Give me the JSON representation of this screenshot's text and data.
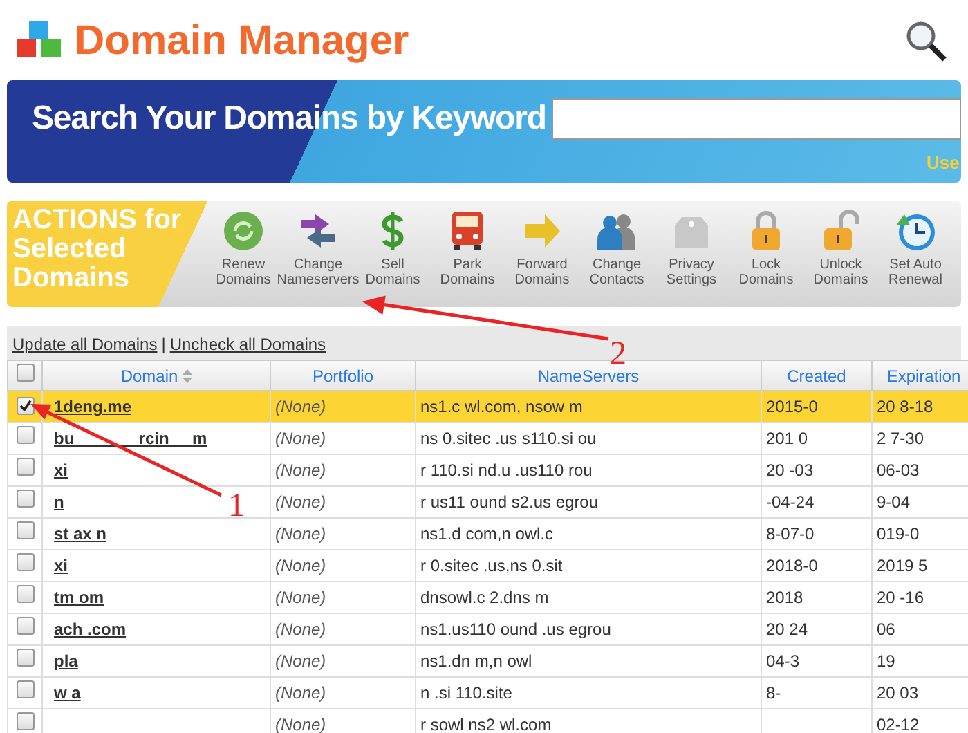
{
  "header": {
    "title": "Domain Manager"
  },
  "banner": {
    "title": "Search Your Domains by Keyword",
    "hint": "Use"
  },
  "actions": {
    "title": "ACTIONS for Selected Domains",
    "items": [
      {
        "kind": "renew",
        "label": "Renew Domains"
      },
      {
        "kind": "nameservers",
        "label": "Change Nameservers"
      },
      {
        "kind": "sell",
        "label": "Sell Domains"
      },
      {
        "kind": "park",
        "label": "Park Domains"
      },
      {
        "kind": "forward",
        "label": "Forward Domains"
      },
      {
        "kind": "contacts",
        "label": "Change Contacts"
      },
      {
        "kind": "privacy",
        "label": "Privacy Settings"
      },
      {
        "kind": "lock",
        "label": "Lock Domains"
      },
      {
        "kind": "unlock",
        "label": "Unlock Domains"
      },
      {
        "kind": "autorenew",
        "label": "Set Auto Renewal"
      }
    ]
  },
  "links": [
    "Update all Domains",
    "Uncheck all Domains"
  ],
  "links_separator": "|",
  "table": {
    "columns": [
      "Domain",
      "Portfolio",
      "NameServers",
      "Created",
      "Expiration"
    ],
    "header_checked": false,
    "rows": [
      {
        "checked": true,
        "domain": "1deng.me",
        "portfolio": "(None)",
        "nameservers": "ns1.c wl.com, nsow m",
        "created": "2015-0",
        "expiration": "20 8-18"
      },
      {
        "checked": false,
        "domain": "bu              rcin     m",
        "portfolio": "(None)",
        "nameservers": "ns 0.sitec .us s110.si ou",
        "created": "201 0",
        "expiration": "2 7-30"
      },
      {
        "checked": false,
        "domain": "xi",
        "portfolio": "(None)",
        "nameservers": "r 110.si nd.u .us110 rou",
        "created": "20 -03",
        "expiration": "06-03"
      },
      {
        "checked": false,
        "domain": "n",
        "annotation": "1",
        "portfolio": "(None)",
        "nameservers": "r us11 ound s2.us egrou",
        "created": "-04-24",
        "expiration": "9-04"
      },
      {
        "checked": false,
        "domain": "st ax n",
        "portfolio": "(None)",
        "nameservers": "ns1.d com,n owl.c",
        "created": "8-07-0",
        "expiration": "019-0"
      },
      {
        "checked": false,
        "domain": "xi",
        "portfolio": "(None)",
        "nameservers": "r 0.sitec .us,ns 0.sit",
        "created": "2018-0",
        "expiration": "2019 5"
      },
      {
        "checked": false,
        "domain": "tm om",
        "portfolio": "(None)",
        "nameservers": "dnsowl.c 2.dns m",
        "created": "2018",
        "expiration": "20 -16"
      },
      {
        "checked": false,
        "domain": "ach .com",
        "portfolio": "(None)",
        "nameservers": "ns1.us110 ound .us egrou",
        "created": "20 24",
        "expiration": "06"
      },
      {
        "checked": false,
        "domain": "pla",
        "portfolio": "(None)",
        "nameservers": "ns1.dn m,n owl",
        "created": "04-3",
        "expiration": "19"
      },
      {
        "checked": false,
        "domain": "w a",
        "portfolio": "(None)",
        "nameservers": "n .si 110.site",
        "created": "8-",
        "expiration": "20 03"
      },
      {
        "checked": false,
        "portfolio": "(None)",
        "nameservers": "r sowl ns2 wl.com",
        "expiration": "02-12"
      }
    ]
  },
  "annotation": "2"
}
